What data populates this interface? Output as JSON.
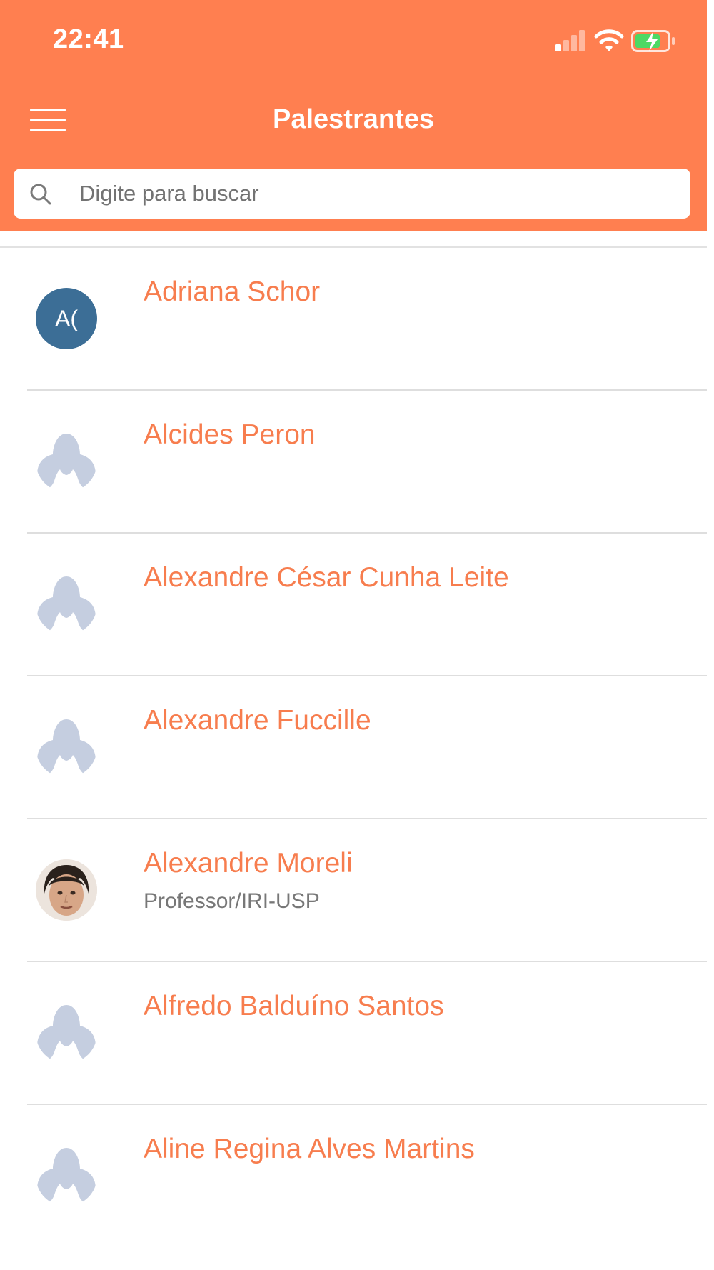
{
  "status_bar": {
    "time": "22:41",
    "icons": [
      "signal-icon",
      "wifi-icon",
      "battery-charging-icon"
    ]
  },
  "header": {
    "title": "Palestrantes",
    "menu_icon": "hamburger-menu-icon",
    "background_color": "#FF7F50"
  },
  "search": {
    "placeholder": "Digite para buscar",
    "value": "",
    "icon": "search-icon"
  },
  "speakers": [
    {
      "name": "Adriana Schor",
      "subtitle": "",
      "avatar_type": "initials",
      "initials": "A("
    },
    {
      "name": "Alcides Peron",
      "subtitle": "",
      "avatar_type": "placeholder"
    },
    {
      "name": "Alexandre César Cunha Leite",
      "subtitle": "",
      "avatar_type": "placeholder"
    },
    {
      "name": "Alexandre Fuccille",
      "subtitle": "",
      "avatar_type": "placeholder"
    },
    {
      "name": "Alexandre Moreli",
      "subtitle": "Professor/IRI-USP",
      "avatar_type": "photo"
    },
    {
      "name": "Alfredo Balduíno Santos",
      "subtitle": "",
      "avatar_type": "placeholder"
    },
    {
      "name": "Aline Regina Alves Martins",
      "subtitle": "",
      "avatar_type": "placeholder"
    }
  ],
  "colors": {
    "accent": "#FF7F50",
    "name_text": "#F77D4E",
    "initials_avatar": "#3C6E96",
    "placeholder_avatar": "#C5CEE0"
  }
}
